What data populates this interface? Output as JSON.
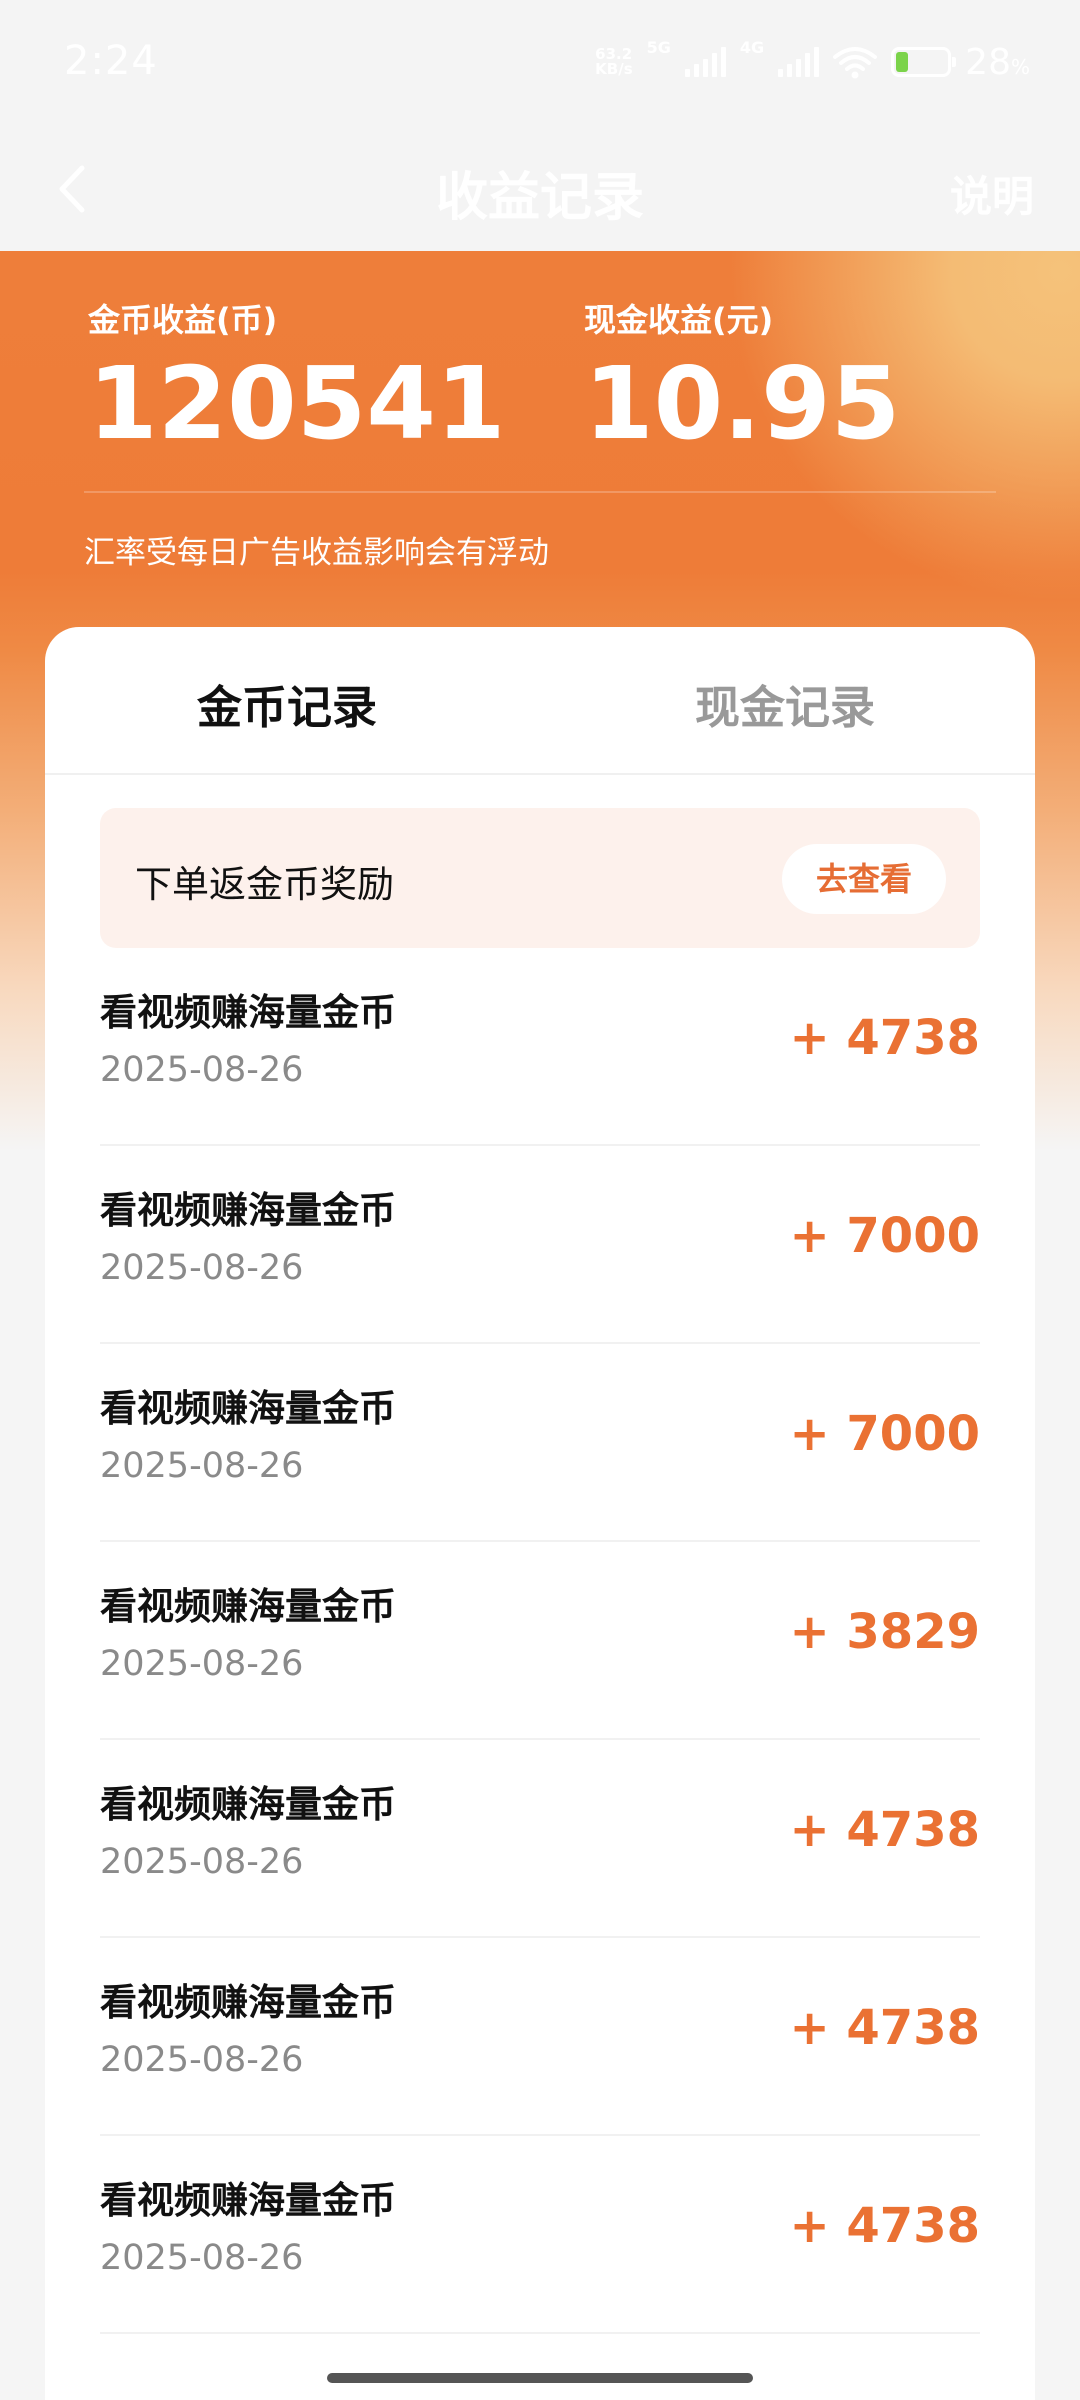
{
  "status_bar": {
    "time": "2:24",
    "net_speed_value": "63.2",
    "net_speed_unit": "KB/s",
    "sim1_label": "5G",
    "sim2_label": "4G",
    "battery_percent": "28",
    "battery_unit": "%"
  },
  "nav": {
    "title": "收益记录",
    "explain_label": "说明"
  },
  "summary": {
    "coin_label": "金币收益(币)",
    "coin_value": "120541",
    "cash_label": "现金收益(元)",
    "cash_value": "10.95",
    "rate_note": "汇率受每日广告收益影响会有浮动"
  },
  "tabs": [
    {
      "label": "金币记录",
      "active": true
    },
    {
      "label": "现金记录",
      "active": false
    }
  ],
  "promo": {
    "text": "下单返金币奖励",
    "button_label": "去查看"
  },
  "records": [
    {
      "title": "看视频赚海量金币",
      "date": "2025-08-26",
      "amount": "+ 4738"
    },
    {
      "title": "看视频赚海量金币",
      "date": "2025-08-26",
      "amount": "+ 7000"
    },
    {
      "title": "看视频赚海量金币",
      "date": "2025-08-26",
      "amount": "+ 7000"
    },
    {
      "title": "看视频赚海量金币",
      "date": "2025-08-26",
      "amount": "+ 3829"
    },
    {
      "title": "看视频赚海量金币",
      "date": "2025-08-26",
      "amount": "+ 4738"
    },
    {
      "title": "看视频赚海量金币",
      "date": "2025-08-26",
      "amount": "+ 4738"
    },
    {
      "title": "看视频赚海量金币",
      "date": "2025-08-26",
      "amount": "+ 4738"
    }
  ],
  "colors": {
    "accent": "#ea7133",
    "banner": "#ee7e3a",
    "promo_bg": "#fdf1ec"
  },
  "icons": {
    "back": "chevron-left-icon",
    "wifi": "wifi-icon",
    "battery": "battery-icon",
    "signal": "signal-icon"
  }
}
